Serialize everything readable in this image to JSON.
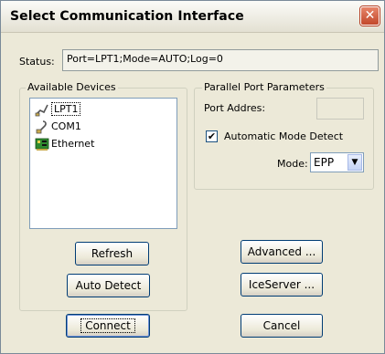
{
  "window": {
    "title": "Select Communication Interface"
  },
  "status": {
    "label": "Status:",
    "value": "Port=LPT1;Mode=AUTO;Log=0"
  },
  "available_devices": {
    "label": "Available Devices",
    "items": [
      {
        "label": "LPT1",
        "icon": "parallel-port-icon",
        "selected": true
      },
      {
        "label": "COM1",
        "icon": "serial-port-icon",
        "selected": false
      },
      {
        "label": "Ethernet",
        "icon": "network-card-icon",
        "selected": false
      }
    ]
  },
  "parallel_port": {
    "label": "Parallel Port Parameters",
    "port_address_label": "Port Addres:",
    "port_address_value": "",
    "auto_detect_label": "Automatic Mode Detect",
    "auto_detect_checked": true,
    "mode_label": "Mode:",
    "mode_value": "EPP"
  },
  "buttons": {
    "refresh": "Refresh",
    "auto_detect": "Auto Detect",
    "advanced": "Advanced ...",
    "iceserver": "IceServer ...",
    "connect": "Connect",
    "cancel": "Cancel"
  }
}
